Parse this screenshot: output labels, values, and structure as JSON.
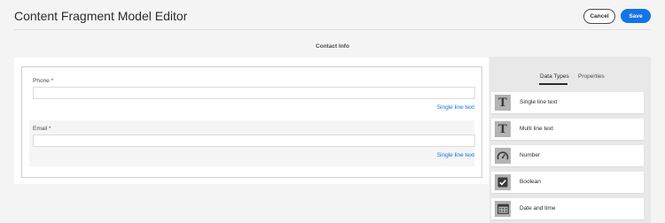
{
  "header": {
    "title": "Content Fragment Model Editor",
    "cancel_label": "Cancel",
    "save_label": "Save"
  },
  "model": {
    "name": "Contact Info"
  },
  "fields": [
    {
      "label": "Phone *",
      "value": "",
      "type": "Single line text"
    },
    {
      "label": "Email *",
      "value": "",
      "type": "Single line text"
    }
  ],
  "panel": {
    "tabs": [
      {
        "label": "Data Types",
        "active": true
      },
      {
        "label": "Properties",
        "active": false
      }
    ],
    "data_types": [
      {
        "label": "Single line text",
        "icon": "text-icon"
      },
      {
        "label": "Multi line text",
        "icon": "text-icon"
      },
      {
        "label": "Number",
        "icon": "gauge-icon"
      },
      {
        "label": "Boolean",
        "icon": "checkbox-icon"
      },
      {
        "label": "Date and time",
        "icon": "calendar-icon"
      }
    ]
  },
  "colors": {
    "accent": "#1473e6",
    "background": "#f4f4f4",
    "panel": "#e8e8e8"
  }
}
